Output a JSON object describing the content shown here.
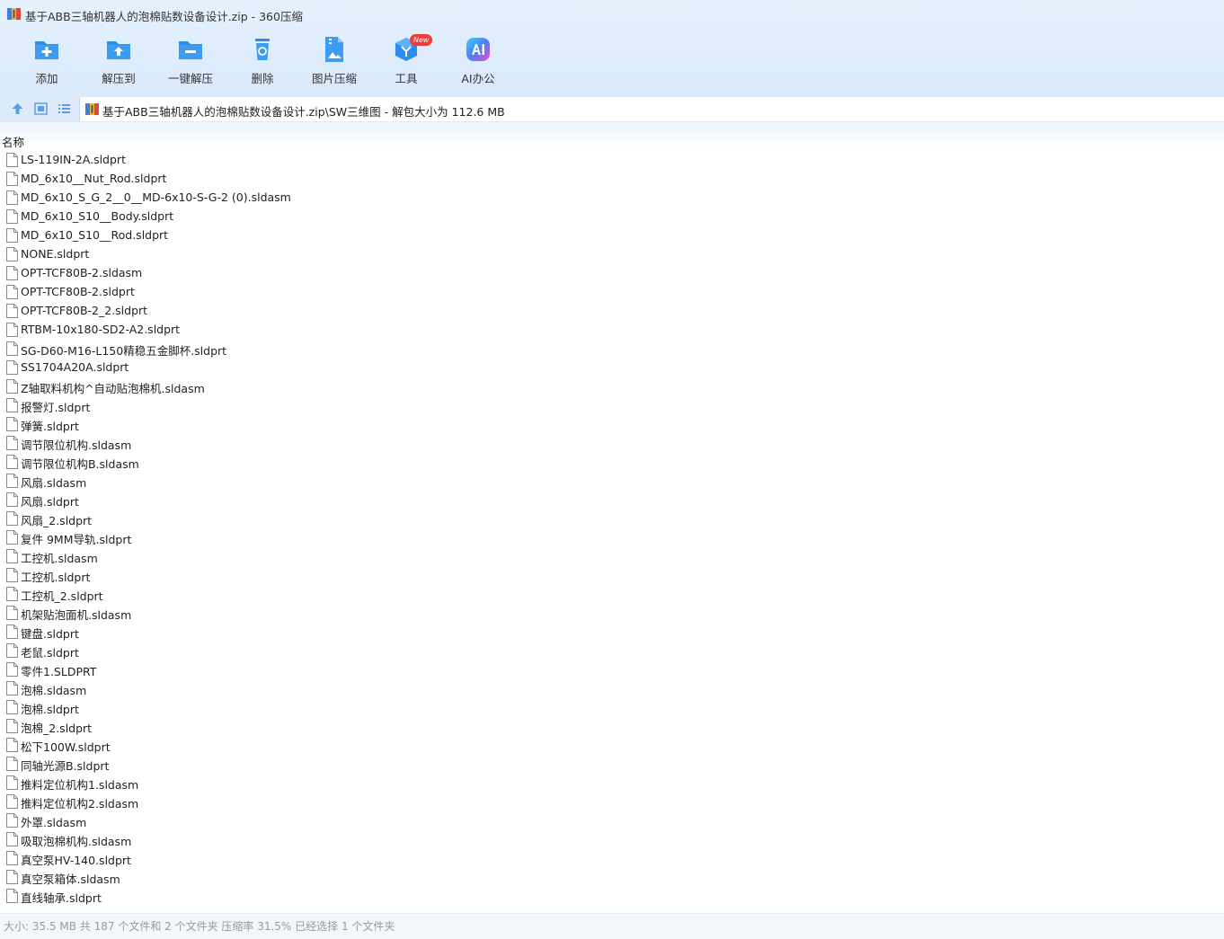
{
  "window": {
    "title": "基于ABB三轴机器人的泡棉贴数设备设计.zip - 360压缩"
  },
  "toolbar": {
    "items": [
      {
        "label": "添加",
        "icon": "add-folder-icon"
      },
      {
        "label": "解压到",
        "icon": "extract-to-icon"
      },
      {
        "label": "一键解压",
        "icon": "one-click-extract-icon"
      },
      {
        "label": "删除",
        "icon": "trash-icon"
      },
      {
        "label": "图片压缩",
        "icon": "image-compress-icon"
      },
      {
        "label": "工具",
        "icon": "tools-cube-icon",
        "badge": "New"
      },
      {
        "label": "AI办公",
        "icon": "ai-office-icon"
      }
    ],
    "accent": "#2b8ff0",
    "badge_color": "#ee3b3b"
  },
  "address": {
    "path": "基于ABB三轴机器人的泡棉贴数设备设计.zip\\SW三维图 - 解包大小为 112.6 MB"
  },
  "list": {
    "column_name": "名称",
    "files": [
      "LS-119IN-2A.sldprt",
      "MD_6x10__Nut_Rod.sldprt",
      "MD_6x10_S_G_2__0__MD-6x10-S-G-2 (0).sldasm",
      "MD_6x10_S10__Body.sldprt",
      "MD_6x10_S10__Rod.sldprt",
      "NONE.sldprt",
      "OPT-TCF80B-2.sldasm",
      "OPT-TCF80B-2.sldprt",
      "OPT-TCF80B-2_2.sldprt",
      "RTBM-10x180-SD2-A2.sldprt",
      "SG-D60-M16-L150精稳五金脚杯.sldprt",
      "SS1704A20A.sldprt",
      "Z轴取料机构^自动贴泡棉机.sldasm",
      "报警灯.sldprt",
      "弹簧.sldprt",
      "调节限位机构.sldasm",
      "调节限位机构B.sldasm",
      "风扇.sldasm",
      "风扇.sldprt",
      "风扇_2.sldprt",
      "复件 9MM导轨.sldprt",
      "工控机.sldasm",
      "工控机.sldprt",
      "工控机_2.sldprt",
      "机架贴泡面机.sldasm",
      "键盘.sldprt",
      "老鼠.sldprt",
      "零件1.SLDPRT",
      "泡棉.sldasm",
      "泡棉.sldprt",
      "泡棉_2.sldprt",
      "松下100W.sldprt",
      "同轴光源B.sldprt",
      "推料定位机构1.sldasm",
      "推料定位机构2.sldasm",
      "外罩.sldasm",
      "吸取泡棉机构.sldasm",
      "真空泵HV-140.sldprt",
      "真空泵箱体.sldasm",
      "直线轴承.sldprt"
    ]
  },
  "status": {
    "text": "大小: 35.5 MB 共 187 个文件和 2 个文件夹 压缩率 31.5% 已经选择 1 个文件夹"
  }
}
